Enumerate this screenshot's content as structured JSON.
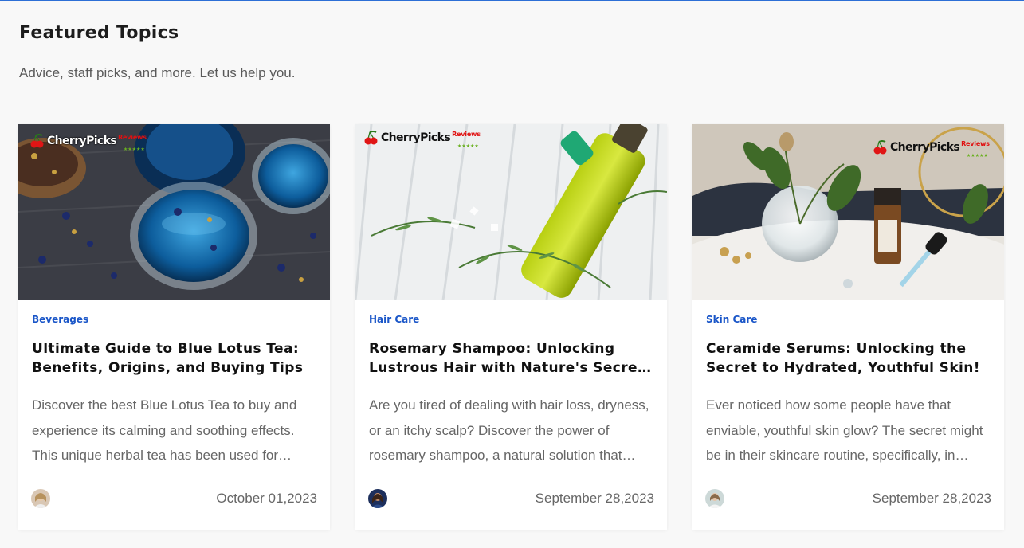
{
  "section": {
    "title": "Featured Topics",
    "subtitle": "Advice, staff picks, and more. Let us help you."
  },
  "logo": {
    "brand": "CherryPicks",
    "tag": "Reviews",
    "stars": "★★★★★"
  },
  "cards": [
    {
      "category": "Beverages",
      "title": "Ultimate Guide to Blue Lotus Tea: Benefits, Origins, and Buying Tips",
      "excerpt": "Discover the best Blue Lotus Tea to buy and experience its calming and soothing effects. This unique herbal tea has been used for centuries across many cultures.",
      "date": "October 01,2023"
    },
    {
      "category": "Hair Care",
      "title": "Rosemary Shampoo: Unlocking Lustrous Hair with Nature's Secret Ingredient",
      "excerpt": "Are you tired of dealing with hair loss, dryness, or an itchy scalp? Discover the power of rosemary shampoo, a natural solution that nourishes your scalp.",
      "date": "September 28,2023"
    },
    {
      "category": "Skin Care",
      "title": "Ceramide Serums: Unlocking the Secret to Hydrated, Youthful Skin!",
      "excerpt": "Ever noticed how some people have that enviable, youthful skin glow? The secret might be in their skincare routine, specifically, in ceramide serums.",
      "date": "September 28,2023"
    }
  ]
}
